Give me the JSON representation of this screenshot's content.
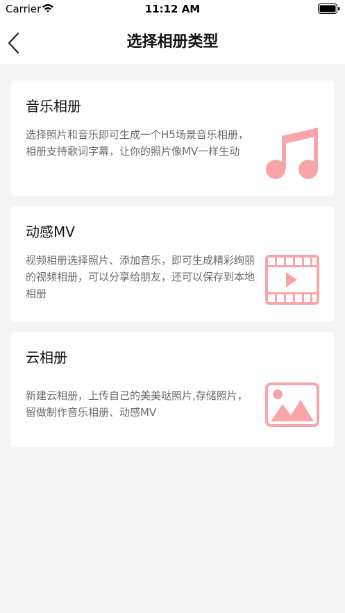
{
  "status_bar": {
    "carrier": "Carrier",
    "time": "11:12 AM",
    "wifi_icon": "wifi-icon",
    "battery_icon": "battery-icon"
  },
  "nav": {
    "back_icon": "chevron-left-icon",
    "title": "选择相册类型"
  },
  "colors": {
    "accent": "#f7a5a9",
    "background": "#f5f5f5",
    "card": "#ffffff",
    "title_text": "#111111",
    "desc_text": "#6b6b6b"
  },
  "cards": [
    {
      "title": "音乐相册",
      "description": "选择照片和音乐即可生成一个H5场景音乐相册，相册支持歌词字幕，让你的照片像MV一样生动",
      "icon": "music-note-icon"
    },
    {
      "title": "动感MV",
      "description": "视频相册选择照片、添加音乐，即可生成精彩绚丽的视频相册，可以分享给朋友，还可以保存到本地相册",
      "icon": "video-film-icon"
    },
    {
      "title": "云相册",
      "description": "新建云相册，上传自己的美美哒照片,存储照片，留做制作音乐相册、动感MV",
      "icon": "image-icon"
    }
  ]
}
